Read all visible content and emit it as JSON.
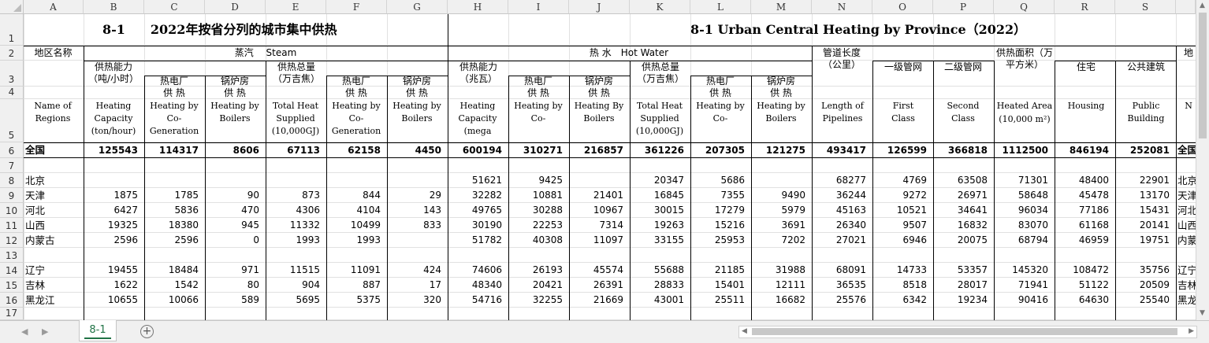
{
  "sheet": {
    "columns": [
      "A",
      "B",
      "C",
      "D",
      "E",
      "F",
      "G",
      "H",
      "I",
      "J",
      "K",
      "L",
      "M",
      "N",
      "O",
      "P",
      "Q",
      "R",
      "S"
    ],
    "row_numbers": [
      "1",
      "2",
      "3",
      "4",
      "5",
      "6",
      "7",
      "8",
      "9",
      "10",
      "11",
      "12",
      "13",
      "14",
      "15",
      "16",
      "17"
    ],
    "tab_name": "8-1",
    "add_sheet": "⊕"
  },
  "titles": {
    "cn": "8-1　　2022年按省分列的城市集中供热",
    "en": "8-1 Urban Central Heating by Province（2022）"
  },
  "headers": {
    "region_cn": "地区名称",
    "region_en": "Name of Regions",
    "steam": "蒸汽　 Steam",
    "hotwater": "热 水　Hot Water",
    "pipe_cn": "管道长度（公里）",
    "pipe_en": "Length of Pipelines (km)",
    "first_cn": "一级管网",
    "first_en": "First Class",
    "second_cn": "二级管网",
    "second_en": "Second Class",
    "area_cn": "供热面积（万平方米）",
    "area_en": "Heated Area",
    "area_en2": "(10,000 m²)",
    "housing_cn": "住宅",
    "housing_en": "Housing",
    "public_cn": "公共建筑",
    "public_en": "Public Building",
    "s_cap_cn": "供热能力（吨/小时）",
    "s_cap_en": "Heating Capacity (ton/hour)",
    "s_cogen_cn": "热电厂 供 热",
    "s_cogen_en": "Heating by Co-Generation",
    "s_boil_cn": "锅炉房 供 热",
    "s_boil_en": "Heating by Boilers",
    "s_total_cn": "供热总量（万吉焦）",
    "s_total_en": "Total Heat Supplied (10,000GJ)",
    "s_cogen2_cn": "热电厂 供 热",
    "s_cogen2_en": "Heating by Co-Generation",
    "s_boil2_cn": "锅炉房 供 热",
    "s_boil2_en": "Heating by Boilers",
    "w_cap_cn": "供热能力（兆瓦）",
    "w_cap_en": "Heating Capacity (mega watts)",
    "w_cogen_cn": "热电厂 供 热",
    "w_cogen_en": "Heating by Co-Generation",
    "w_boil_cn": "锅炉房 供 热",
    "w_boil_en": "Heating By Boilers",
    "w_total_cn": "供热总量（万吉焦）",
    "w_total_en": "Total Heat Supplied (10,000GJ)",
    "w_cogen2_cn": "热电厂 供 热",
    "w_cogen2_en": "Heating by Co-Generation",
    "w_boil2_cn": "锅炉房 供 热",
    "w_boil2_en": "Heating by Boilers",
    "cut_cn": "地",
    "cut_en": "N"
  },
  "rows": [
    {
      "row": "6",
      "name": "全国",
      "bold": true,
      "cut": "全国",
      "values": [
        "125543",
        "114317",
        "8606",
        "67113",
        "62158",
        "4450",
        "600194",
        "310271",
        "216857",
        "361226",
        "207305",
        "121275",
        "493417",
        "126599",
        "366818",
        "1112500",
        "846194",
        "252081"
      ]
    },
    {
      "row": "8",
      "name": "北京",
      "cut": "北京",
      "values": [
        "",
        "",
        "",
        "",
        "",
        "",
        "51621",
        "9425",
        "",
        "20347",
        "5686",
        "",
        "68277",
        "4769",
        "63508",
        "71301",
        "48400",
        "22901"
      ]
    },
    {
      "row": "9",
      "name": "天津",
      "cut": "天津",
      "values": [
        "1875",
        "1785",
        "90",
        "873",
        "844",
        "29",
        "32282",
        "10881",
        "21401",
        "16845",
        "7355",
        "9490",
        "36244",
        "9272",
        "26971",
        "58648",
        "45478",
        "13170"
      ]
    },
    {
      "row": "10",
      "name": "河北",
      "cut": "河北",
      "values": [
        "6427",
        "5836",
        "470",
        "4306",
        "4104",
        "143",
        "49765",
        "30288",
        "10967",
        "30015",
        "17279",
        "5979",
        "45163",
        "10521",
        "34641",
        "96034",
        "77186",
        "15431"
      ]
    },
    {
      "row": "11",
      "name": "山西",
      "cut": "山西",
      "values": [
        "19325",
        "18380",
        "945",
        "11332",
        "10499",
        "833",
        "30190",
        "22253",
        "7314",
        "19263",
        "15216",
        "3691",
        "26340",
        "9507",
        "16832",
        "83070",
        "61168",
        "20141"
      ]
    },
    {
      "row": "12",
      "name": "内蒙古",
      "cut": "内蒙",
      "values": [
        "2596",
        "2596",
        "0",
        "1993",
        "1993",
        "",
        "51782",
        "40308",
        "11097",
        "33155",
        "25953",
        "7202",
        "27021",
        "6946",
        "20075",
        "68794",
        "46959",
        "19751"
      ]
    },
    {
      "row": "14",
      "name": "辽宁",
      "cut": "辽宁",
      "values": [
        "19455",
        "18484",
        "971",
        "11515",
        "11091",
        "424",
        "74606",
        "26193",
        "45574",
        "55688",
        "21185",
        "31988",
        "68091",
        "14733",
        "53357",
        "145320",
        "108472",
        "35756"
      ]
    },
    {
      "row": "15",
      "name": "吉林",
      "cut": "吉林",
      "values": [
        "1622",
        "1542",
        "80",
        "904",
        "887",
        "17",
        "48340",
        "20421",
        "26391",
        "28833",
        "15401",
        "12111",
        "36535",
        "8518",
        "28017",
        "71941",
        "51122",
        "20509"
      ]
    },
    {
      "row": "16",
      "name": "黑龙江",
      "cut": "黑龙",
      "values": [
        "10655",
        "10066",
        "589",
        "5695",
        "5375",
        "320",
        "54716",
        "32255",
        "21669",
        "43001",
        "25511",
        "16682",
        "25576",
        "6342",
        "19234",
        "90416",
        "64630",
        "25540"
      ]
    }
  ]
}
